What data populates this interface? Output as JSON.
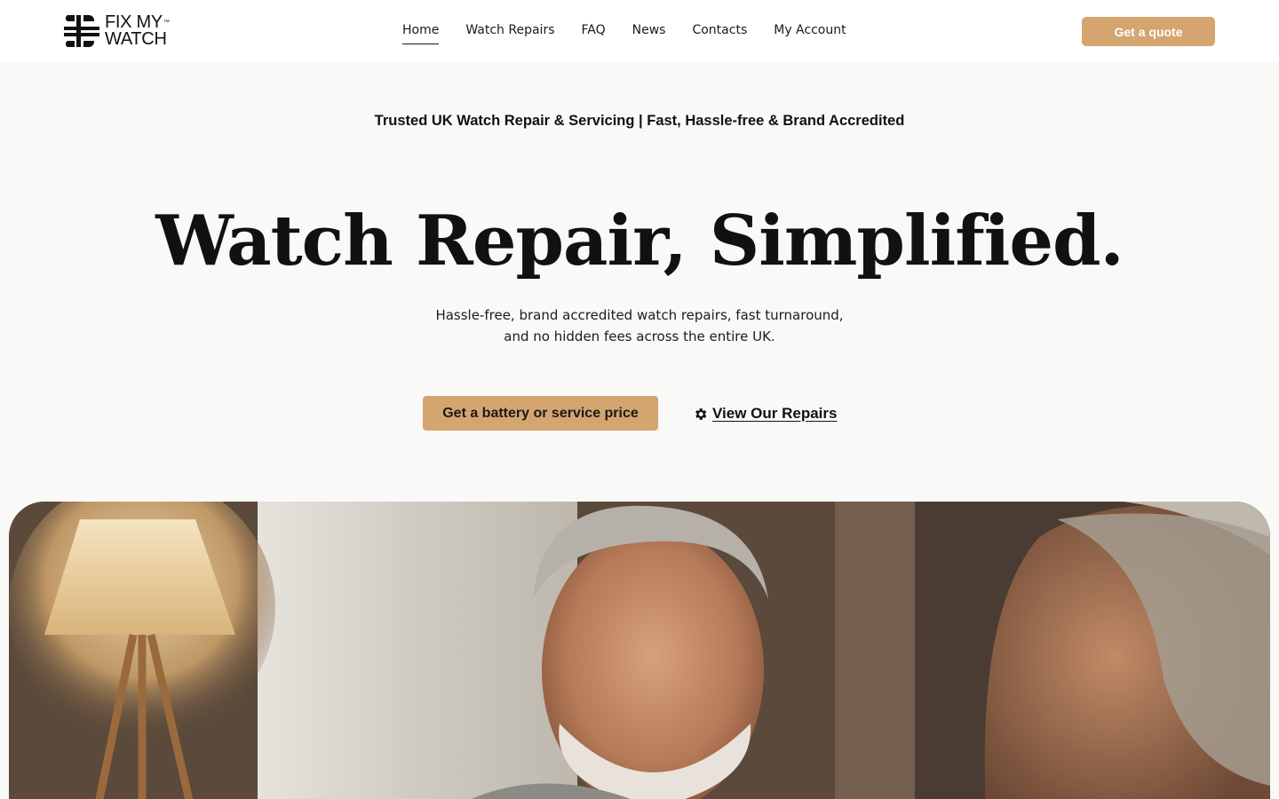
{
  "brand": {
    "line1": "FIX MY",
    "line2": "WATCH",
    "trademark": "™"
  },
  "nav": {
    "items": [
      {
        "label": "Home",
        "active": true
      },
      {
        "label": "Watch Repairs",
        "active": false
      },
      {
        "label": "FAQ",
        "active": false
      },
      {
        "label": "News",
        "active": false
      },
      {
        "label": "Contacts",
        "active": false
      },
      {
        "label": "My Account",
        "active": false
      }
    ],
    "quote_button": "Get a quote"
  },
  "hero": {
    "trust_line": "Trusted UK Watch Repair & Servicing | Fast, Hassle-free & Brand Accredited",
    "headline": "Watch Repair, Simplified.",
    "subtext_line1": "Hassle-free, brand accredited watch repairs, fast turnaround,",
    "subtext_line2": "and no hidden fees across the entire UK.",
    "primary_cta": "Get a battery or service price",
    "secondary_cta": "View Our Repairs",
    "secondary_cta_icon": "gear-icon",
    "image_alt_subject": "smiling older man and woman in a warm living room"
  },
  "colors": {
    "accent": "#d4a56f",
    "background": "#f9f9f7",
    "header_bg": "#ffffff",
    "text": "#111111"
  }
}
